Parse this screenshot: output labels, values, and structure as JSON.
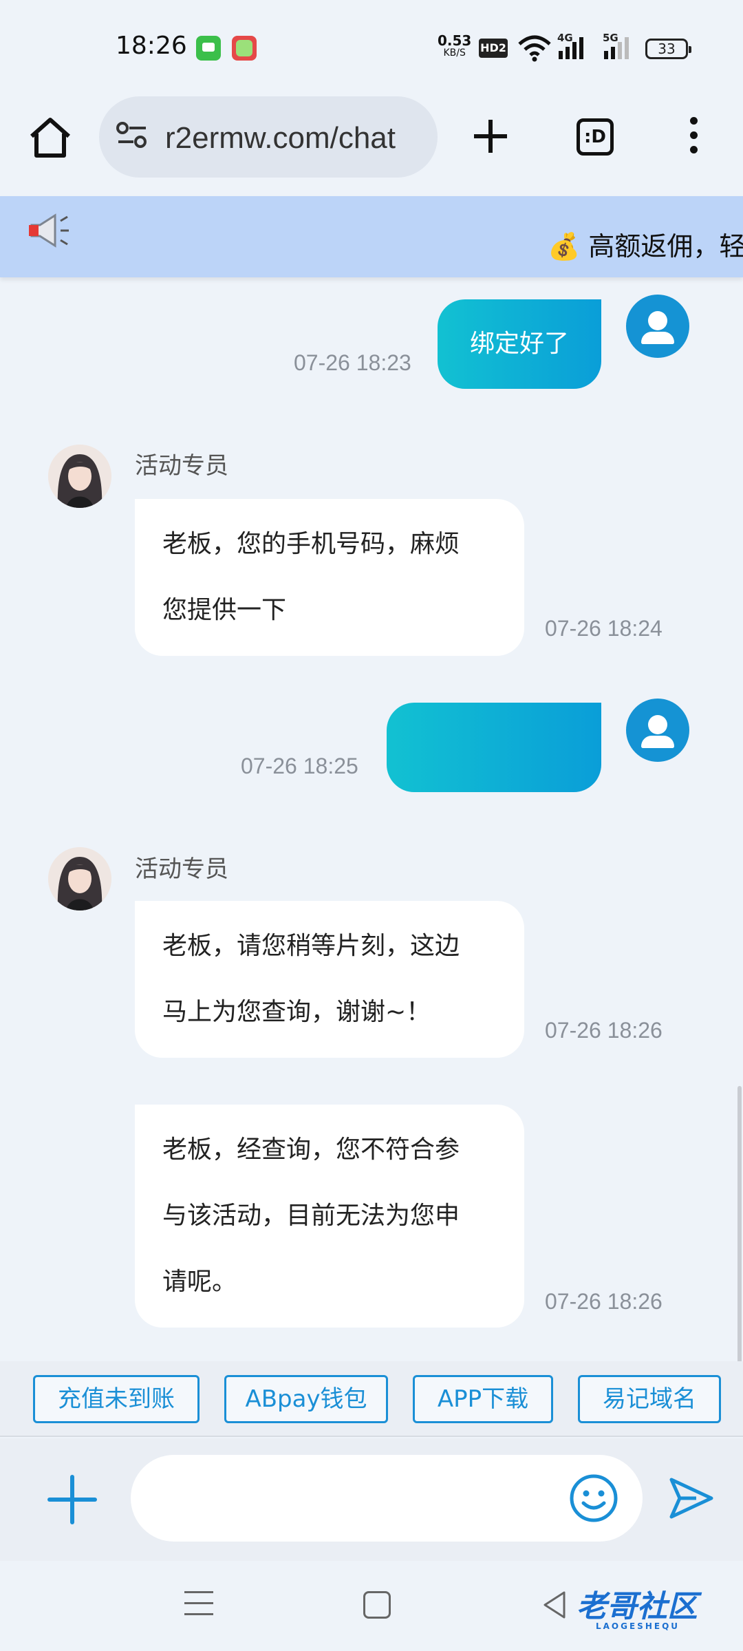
{
  "status_bar": {
    "time": "18:26",
    "net_speed": "0.53",
    "net_unit": "KB/S",
    "hd_label": "HD2",
    "sig1_label": "4G",
    "sig2_label": "5G",
    "battery": "33"
  },
  "browser": {
    "url": "r2ermw.com/chat",
    "tabs_label": ":D"
  },
  "banner": {
    "text": "💰 高额返佣，轻"
  },
  "messages": [
    {
      "from": "user",
      "text": "绑定好了",
      "time": "07-26 18:23"
    },
    {
      "from": "agent",
      "sender": "活动专员",
      "lines": [
        "老板，您的手机号码，麻烦",
        "您提供一下"
      ],
      "time": "07-26 18:24"
    },
    {
      "from": "user",
      "text": "",
      "time": "07-26 18:25"
    },
    {
      "from": "agent",
      "sender": "活动专员",
      "lines": [
        "老板，请您稍等片刻，这边",
        "马上为您查询，谢谢~！"
      ],
      "time": "07-26 18:26"
    },
    {
      "from": "agent",
      "lines": [
        "老板，经查询，您不符合参",
        "与该活动，目前无法为您申",
        "请呢。"
      ],
      "time": "07-26 18:26"
    }
  ],
  "quick_replies": [
    "充值未到账",
    "ABpay钱包",
    "APP下载",
    "易记域名"
  ],
  "input": {
    "placeholder": ""
  },
  "watermark": {
    "text": "老哥社区",
    "sub": "LAOGESHEQU"
  },
  "colors": {
    "accent": "#1a8fd6",
    "bubble_gradient_start": "#12c1d2",
    "bubble_gradient_end": "#0a9ed8",
    "banner_bg": "#bcd4f8",
    "page_bg": "#eef3f9"
  }
}
